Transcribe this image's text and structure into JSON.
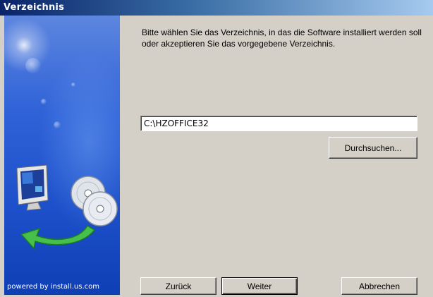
{
  "window": {
    "title": "Verzeichnis"
  },
  "sidebar": {
    "powered_by": "powered by install.us.com",
    "art_icon": "computer-with-cds-icon"
  },
  "main": {
    "instructions": "Bitte wählen Sie das Verzeichnis, in das die Software installiert werden soll oder akzeptieren Sie das vorgegebene Verzeichnis.",
    "path_value": "C:\\HZOFFICE32",
    "browse_label": "Durchsuchen..."
  },
  "footer": {
    "back_label": "Zurück",
    "next_label": "Weiter",
    "cancel_label": "Abbrechen"
  },
  "colors": {
    "titlebar_start": "#0a246a",
    "titlebar_end": "#a6caf0",
    "dialog_bg": "#d4d0c8",
    "sidebar_blue": "#2f62d8"
  }
}
